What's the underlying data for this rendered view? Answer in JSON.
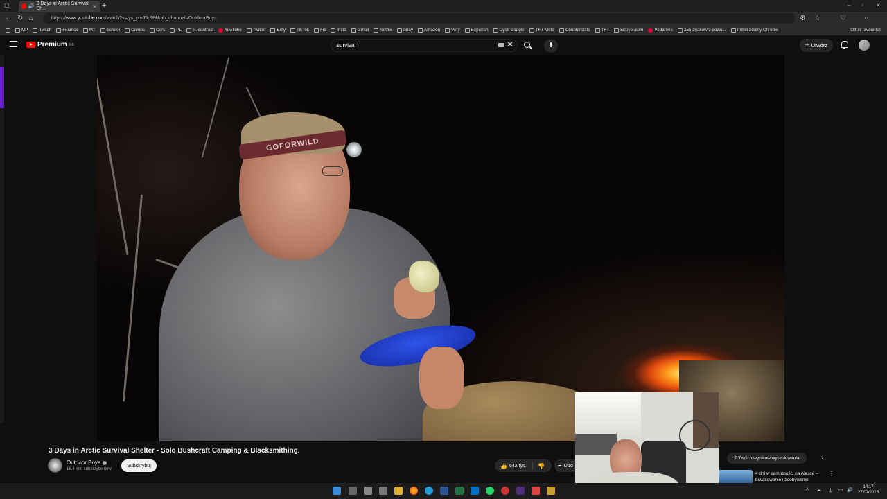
{
  "browser": {
    "tab_title": "3 Days in Arctic Survival Sh...",
    "tab_close": "×",
    "new_tab": "+",
    "url_scheme": "https://",
    "url_host": "www.youtube.com",
    "url_path": "/watch?v=iys_pmJ5p9M&ab_channel=OutdoorBoys",
    "bookmarks": [
      "MP",
      "Twitch",
      "Finance",
      "MT",
      "School",
      "Comps",
      "Cars",
      "PL",
      "S. contract",
      "YouTube",
      "Twitter",
      "Eufy",
      "TikTok",
      "FB",
      "Insta",
      "Gmail",
      "Netflix",
      "eBay",
      "Amazon",
      "Very",
      "Experian",
      "Dysk Google",
      "TFT Meta",
      "Counterstats",
      "TFT",
      "Ebuyer.com",
      "Vodafone",
      "255 znaków z pozio...",
      "Pulpit zdalny Chrome"
    ],
    "other_favourites": "Other favourites"
  },
  "youtube": {
    "logo_text": "Premium",
    "logo_sup": "GB",
    "search_value": "survival",
    "create_label": "Utwórz",
    "video": {
      "title": "3 Days in Arctic Survival Shelter - Solo Bushcraft Camping & Blacksmithing.",
      "headband_text": "GOFORWILD",
      "channel_name": "Outdoor Boys",
      "subscriber_count": "16,4 mln subskrybentów",
      "subscribe_label": "Subskrybuj",
      "likes": "642 tys.",
      "share_label": "Udo"
    },
    "side": {
      "chip_label": "Z Twoich wyników wyszukiwania",
      "rec_title": "4 dni w samotności na Alasce – biwakowanie i zdobywanie"
    }
  },
  "taskbar": {
    "time": "14:17",
    "date": "27/07/2025"
  },
  "colors": {
    "youtube_red": "#ff0000",
    "background": "#0f0f0f"
  }
}
